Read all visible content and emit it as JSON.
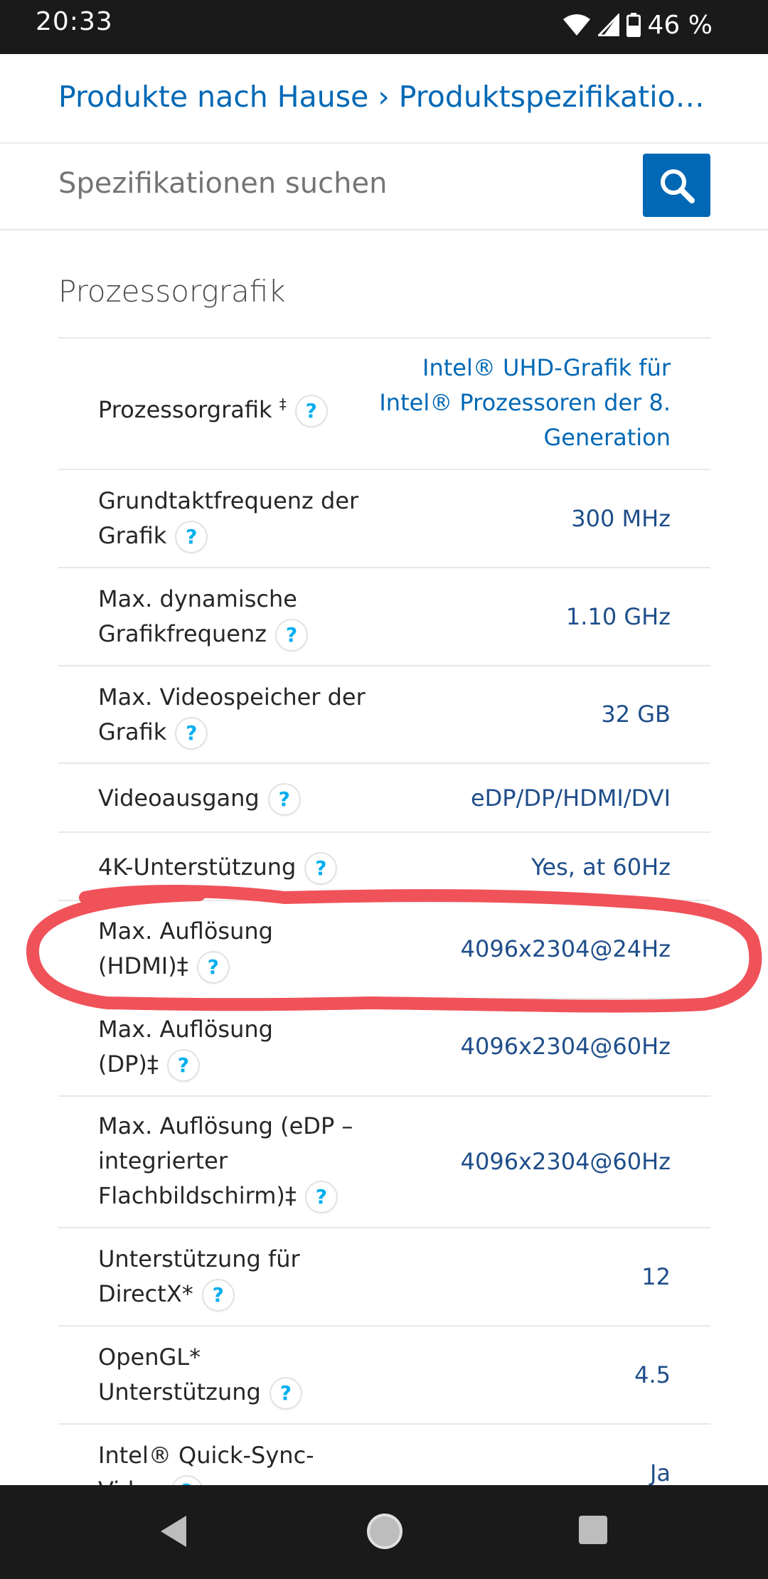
{
  "status_bar": {
    "time": "20:33",
    "battery": "46 %"
  },
  "breadcrumb": "Produkte nach Hause › Produktspezifikationen › Prozessoren",
  "search": {
    "placeholder": "Spezifikationen suchen"
  },
  "section": {
    "title": "Prozessorgrafik"
  },
  "specs": [
    {
      "label": "Prozessorgrafik ‡",
      "value": "Intel® UHD-Grafik für Intel® Prozessoren der 8. Generation"
    },
    {
      "label": "Grundtaktfrequenz der Grafik",
      "value": "300 MHz"
    },
    {
      "label": "Max. dynamische Grafikfrequenz",
      "value": "1.10 GHz"
    },
    {
      "label": "Max. Videospeicher der Grafik",
      "value": "32 GB"
    },
    {
      "label": "Videoausgang",
      "value": "eDP/DP/HDMI/DVI"
    },
    {
      "label": "4K-Unterstützung",
      "value": "Yes, at 60Hz"
    },
    {
      "label": "Max. Auflösung (HDMI)‡",
      "value": "4096x2304@24Hz"
    },
    {
      "label": "Max. Auflösung (DP)‡",
      "value": "4096x2304@60Hz"
    },
    {
      "label": "Max. Auflösung (eDP – integrierter Flachbildschirm)‡",
      "value": "4096x2304@60Hz"
    },
    {
      "label": "Unterstützung für DirectX*",
      "value": "12"
    },
    {
      "label": "OpenGL* Unterstützung",
      "value": "4.5"
    },
    {
      "label": "Intel® Quick-Sync-Video",
      "value": "Ja"
    }
  ],
  "help_glyph": "?",
  "colors": {
    "link": "#0068b5",
    "value": "#1f4e8a",
    "highlight": "#f0525a",
    "help": "#00aeef"
  },
  "icons": {
    "search": "search-icon",
    "help": "help-icon",
    "back": "back-triangle-icon",
    "home": "home-circle-icon",
    "recents": "recents-square-icon"
  }
}
